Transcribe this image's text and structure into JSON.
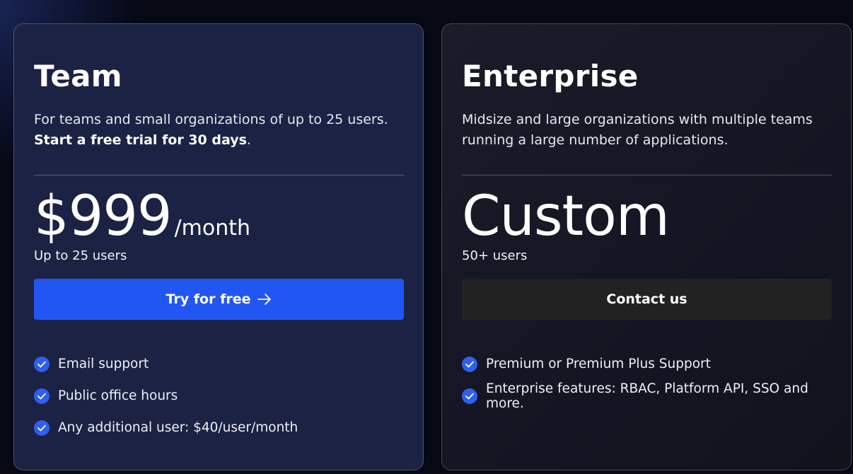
{
  "plans": {
    "team": {
      "name": "Team",
      "description": "For teams and small organizations of up to 25 users.",
      "highlight": "Start a free trial for 30 days",
      "highlight_suffix": ".",
      "price": "$999",
      "period": "/month",
      "users": "Up to 25 users",
      "cta_label": "Try for free",
      "features": [
        "Email support",
        "Public office hours",
        "Any additional user: $40/user/month"
      ]
    },
    "enterprise": {
      "name": "Enterprise",
      "description": "Midsize and large organizations with multiple teams running a large number of applications.",
      "price": "Custom",
      "users": "50+ users",
      "cta_label": "Contact us",
      "features": [
        "Premium or Premium Plus Support",
        "Enterprise features: RBAC, Platform API, SSO and more."
      ]
    }
  },
  "colors": {
    "team_card_bg": "#1b2244",
    "primary_button": "#2256f2",
    "secondary_button": "#222222",
    "check_badge": "#2d5ff0"
  },
  "icons": {
    "cta_arrow": "arrow-right-icon",
    "feature_check": "check-circle-icon"
  }
}
